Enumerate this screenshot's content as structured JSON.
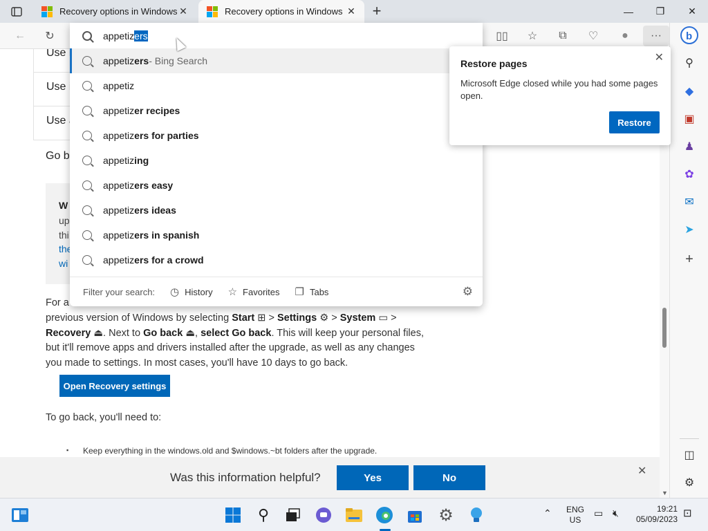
{
  "browser": {
    "tabs": [
      {
        "title": "Recovery options in Windows - M",
        "active": false
      },
      {
        "title": "Recovery options in Windows - M",
        "active": true
      }
    ],
    "address": {
      "typed": "appetiz",
      "autocomplete": "ers"
    },
    "suggestions": [
      {
        "typed": "appetiz",
        "rest": "ers",
        "suffix": " - Bing Search"
      },
      {
        "typed": "appetiz",
        "rest": "",
        "suffix": ""
      },
      {
        "typed": "appetiz",
        "rest": "er recipes",
        "suffix": ""
      },
      {
        "typed": "appetiz",
        "rest": "ers for parties",
        "suffix": ""
      },
      {
        "typed": "appetiz",
        "rest": "ing",
        "suffix": ""
      },
      {
        "typed": "appetiz",
        "rest": "ers easy",
        "suffix": ""
      },
      {
        "typed": "appetiz",
        "rest": "ers ideas",
        "suffix": ""
      },
      {
        "typed": "appetiz",
        "rest": "ers in spanish",
        "suffix": ""
      },
      {
        "typed": "appetiz",
        "rest": "ers for a crowd",
        "suffix": ""
      }
    ],
    "filter": {
      "label": "Filter your search:",
      "history": "History",
      "favorites": "Favorites",
      "tabs": "Tabs"
    }
  },
  "restore_popup": {
    "title": "Restore pages",
    "message": "Microsoft Edge closed while you had some pages open.",
    "button": "Restore"
  },
  "page": {
    "nav_rows": [
      "Use i",
      "Use i",
      "Use a"
    ],
    "go_back": "Go b",
    "note_box": {
      "title": "W",
      "lines": [
        "up",
        "thi",
        "the",
        "wi"
      ]
    },
    "paragraph": {
      "lead": "For a",
      "line2_pre": "previous version of Windows by selecting ",
      "start": "Start",
      "settings": "Settings",
      "system": "System",
      "recovery": "Recovery",
      "sep": ">",
      "next_to": "Next to ",
      "go_back": "Go back",
      "select_go_back": "select Go back",
      "rest": ". This will keep your personal files, but it'll remove apps and drivers installed after the upgrade, as well as any changes you made to settings. In most cases, you'll have 10 days to go back."
    },
    "open_recovery_button": "Open Recovery settings",
    "need_text": "To go back, you'll need to:",
    "bullet": "Keep everything in the windows.old and $windows.~bt folders after the upgrade.",
    "feedback": {
      "question": "Was this information helpful?",
      "yes": "Yes",
      "no": "No"
    }
  },
  "taskbar": {
    "lang_top": "ENG",
    "lang_bottom": "US",
    "time": "19:21",
    "date": "05/09/2023"
  },
  "colors": {
    "accent": "#0067b8",
    "edge_blue": "#0067c0",
    "chrome_bg": "#dfe3e8"
  }
}
